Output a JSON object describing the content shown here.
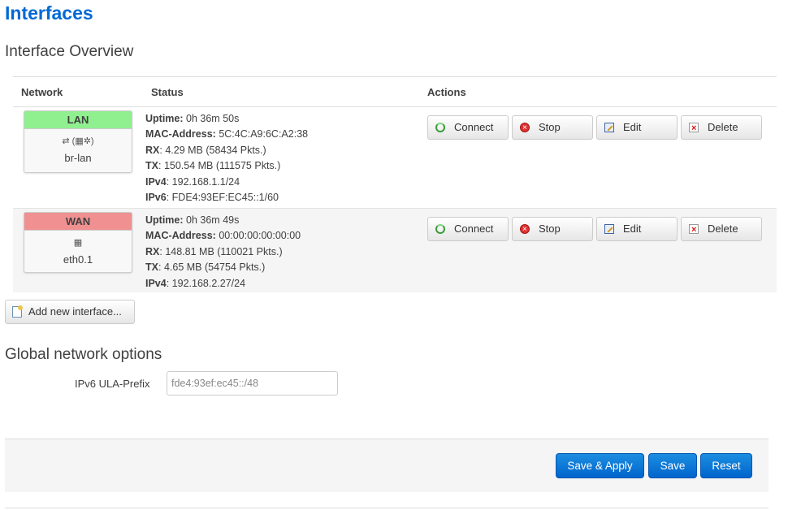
{
  "page": {
    "title": "Interfaces",
    "overview_title": "Interface Overview",
    "global_title": "Global network options"
  },
  "table": {
    "headers": {
      "network": "Network",
      "status": "Status",
      "actions": "Actions"
    }
  },
  "interfaces": [
    {
      "name": "LAN",
      "device": "br-lan",
      "color": "#90f090",
      "status": {
        "uptime_label": "Uptime",
        "uptime": "0h 36m 50s",
        "mac_label": "MAC-Address",
        "mac": "5C:4C:A9:6C:A2:38",
        "rx_label": "RX",
        "rx": "4.29 MB (58434 Pkts.)",
        "tx_label": "TX",
        "tx": "150.54 MB (111575 Pkts.)",
        "ipv4_label": "IPv4",
        "ipv4": "192.168.1.1/24",
        "ipv6_label": "IPv6",
        "ipv6": "FDE4:93EF:EC45::1/60"
      }
    },
    {
      "name": "WAN",
      "device": "eth0.1",
      "color": "#f09090",
      "status": {
        "uptime_label": "Uptime",
        "uptime": "0h 36m 49s",
        "mac_label": "MAC-Address",
        "mac": "00:00:00:00:00:00",
        "rx_label": "RX",
        "rx": "148.81 MB (110021 Pkts.)",
        "tx_label": "TX",
        "tx": "4.65 MB (54754 Pkts.)",
        "ipv4_label": "IPv4",
        "ipv4": "192.168.2.27/24"
      }
    }
  ],
  "actions": {
    "connect": "Connect",
    "stop": "Stop",
    "edit": "Edit",
    "delete": "Delete"
  },
  "add_interface": "Add new interface...",
  "global": {
    "ula_label": "IPv6 ULA-Prefix",
    "ula_value": "fde4:93ef:ec45::/48"
  },
  "footer": {
    "save_apply": "Save & Apply",
    "save": "Save",
    "reset": "Reset"
  },
  "colors": {
    "accent": "#0069d6",
    "primary_button": "#0064cd"
  }
}
